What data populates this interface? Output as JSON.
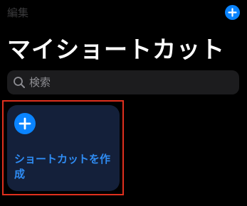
{
  "header": {
    "edit_label": "編集",
    "add_button_icon": "plus-icon"
  },
  "page": {
    "title": "マイショートカット"
  },
  "search": {
    "placeholder": "検索",
    "value": "",
    "icon": "magnifying-glass-icon"
  },
  "create_tile": {
    "icon": "plus-icon",
    "label": "ショートカットを作成"
  },
  "colors": {
    "background": "#000000",
    "accent": "#0a84ff",
    "tile_background": "#14203a",
    "highlight_border": "#e0301e"
  }
}
